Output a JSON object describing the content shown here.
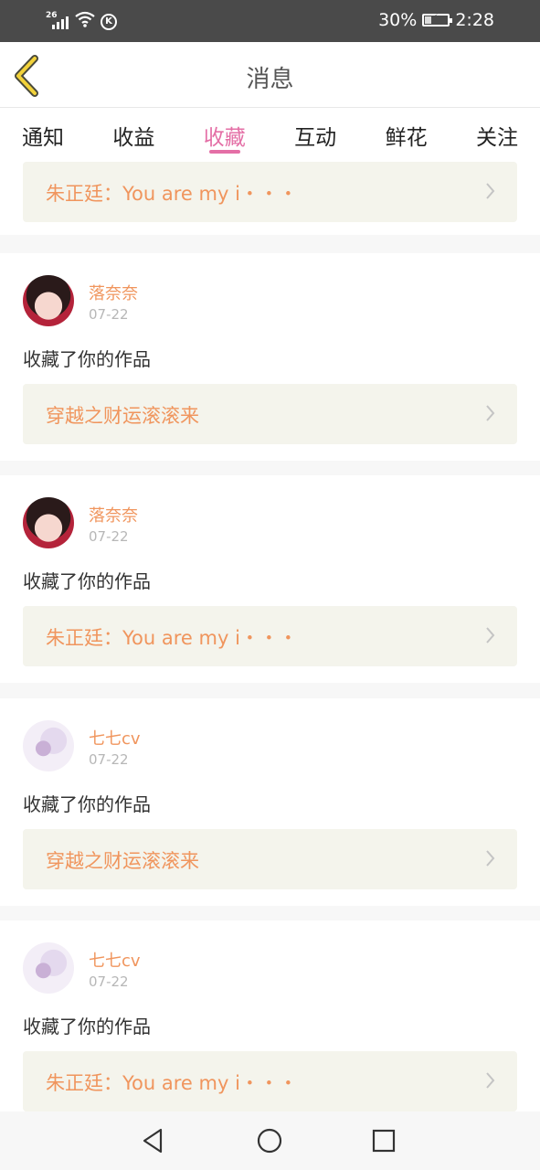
{
  "status_bar": {
    "network": "26",
    "battery_text": "30%",
    "battery_level": 0.3,
    "time": "2:28",
    "icons": [
      "signal-icon",
      "wifi-icon",
      "k-icon",
      "battery-icon"
    ]
  },
  "header": {
    "title": "消息",
    "back_icon": "back-chevron-icon"
  },
  "tabs": [
    {
      "label": "通知",
      "active": false
    },
    {
      "label": "收益",
      "active": false
    },
    {
      "label": "收藏",
      "active": true
    },
    {
      "label": "互动",
      "active": false
    },
    {
      "label": "鲜花",
      "active": false
    },
    {
      "label": "关注",
      "active": false
    }
  ],
  "partial_item": {
    "work_title": "朱正廷：You  are  my  i・・・"
  },
  "items": [
    {
      "user": "落奈奈",
      "date": "07-22",
      "action": "收藏了你的作品",
      "work_title": "穿越之财运滚滚来",
      "avatar": "girl-avatar"
    },
    {
      "user": "落奈奈",
      "date": "07-22",
      "action": "收藏了你的作品",
      "work_title": "朱正廷：You  are  my  i・・・",
      "avatar": "girl-avatar"
    },
    {
      "user": "七七cv",
      "date": "07-22",
      "action": "收藏了你的作品",
      "work_title": "穿越之财运滚滚来",
      "avatar": "flower-avatar"
    },
    {
      "user": "七七cv",
      "date": "07-22",
      "action": "收藏了你的作品",
      "work_title": "朱正廷：You  are  my  i・・・",
      "avatar": "flower-avatar"
    }
  ],
  "colors": {
    "accent": "#e46fa6",
    "name_orange": "#f0955d",
    "work_box_bg": "#f4f4ec",
    "status_bar_bg": "#4a4a4a"
  },
  "nav_bar": [
    "back-triangle-icon",
    "home-circle-icon",
    "recents-square-icon"
  ]
}
